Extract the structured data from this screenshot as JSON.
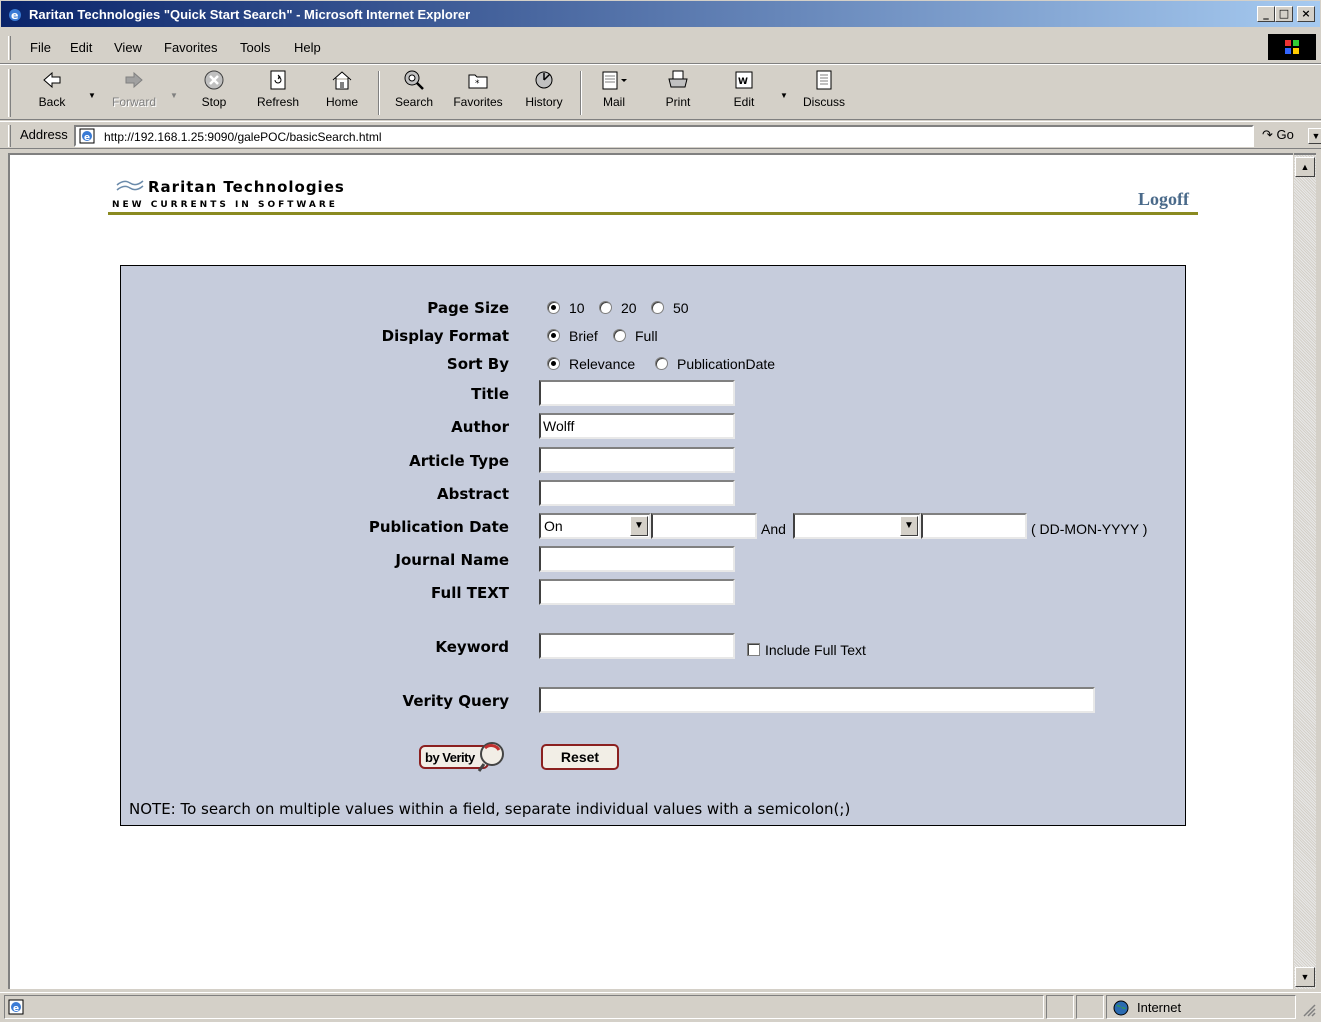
{
  "window": {
    "title": "Raritan Technologies \"Quick Start Search\" - Microsoft Internet Explorer",
    "minimize": "_",
    "maximize": "□",
    "close": "×"
  },
  "menu": [
    "File",
    "Edit",
    "View",
    "Favorites",
    "Tools",
    "Help"
  ],
  "toolbar": {
    "back": "Back",
    "forward": "Forward",
    "stop": "Stop",
    "refresh": "Refresh",
    "home": "Home",
    "search": "Search",
    "favorites": "Favorites",
    "history": "History",
    "mail": "Mail",
    "print": "Print",
    "edit": "Edit",
    "discuss": "Discuss"
  },
  "address": {
    "label": "Address",
    "url": "http://192.168.1.25:9090/galePOC/basicSearch.html",
    "go": "Go"
  },
  "header": {
    "company": "Raritan Technologies",
    "tagline": "NEW CURRENTS IN SOFTWARE",
    "logoff": "Logoff"
  },
  "form": {
    "page_size": {
      "label": "Page Size",
      "options": [
        "10",
        "20",
        "50"
      ],
      "selected": "10"
    },
    "display_format": {
      "label": "Display Format",
      "options": [
        "Brief",
        "Full"
      ],
      "selected": "Brief"
    },
    "sort_by": {
      "label": "Sort By",
      "options": [
        "Relevance",
        "PublicationDate"
      ],
      "selected": "Relevance"
    },
    "title": {
      "label": "Title",
      "value": ""
    },
    "author": {
      "label": "Author",
      "value": "Wolff"
    },
    "article_type": {
      "label": "Article Type",
      "value": ""
    },
    "abstract": {
      "label": "Abstract",
      "value": ""
    },
    "publication_date": {
      "label": "Publication Date",
      "operator": "On",
      "date1": "",
      "and_label": "And",
      "operator2": "",
      "date2": "",
      "format_hint": "( DD-MON-YYYY )"
    },
    "journal_name": {
      "label": "Journal Name",
      "value": ""
    },
    "full_text": {
      "label": "Full TEXT",
      "value": ""
    },
    "keyword": {
      "label": "Keyword",
      "value": "",
      "include_full_text_label": "Include Full Text",
      "include_full_text": false
    },
    "verity_query": {
      "label": "Verity Query",
      "value": ""
    },
    "search_button": "by Verity",
    "reset_button": "Reset",
    "note": "NOTE: To search on multiple values within a field, separate individual values with a semicolon(;)"
  },
  "status": {
    "zone": "Internet"
  }
}
